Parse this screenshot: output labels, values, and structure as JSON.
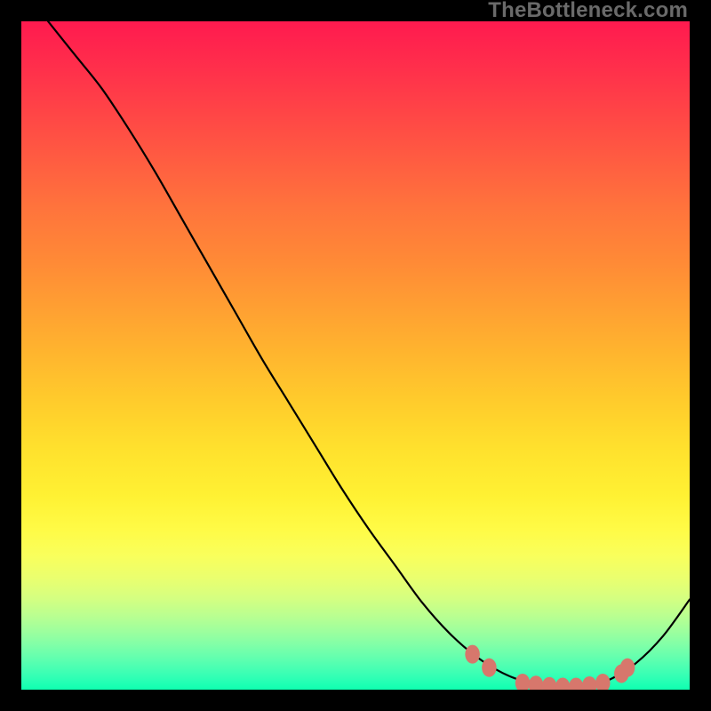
{
  "brand": "TheBottleneck.com",
  "chart_data": {
    "type": "line",
    "title": "",
    "xlabel": "",
    "ylabel": "",
    "xlim": [
      0,
      100
    ],
    "ylim": [
      0,
      100
    ],
    "series": [
      {
        "name": "curve",
        "color": "#000000",
        "x": [
          4,
          8,
          12,
          16,
          20,
          24,
          28,
          32,
          36,
          40,
          44,
          48,
          52,
          56,
          60,
          64,
          68,
          72,
          76,
          80,
          84,
          88,
          92,
          96,
          100
        ],
        "y": [
          100,
          95,
          90,
          84,
          77.5,
          70.5,
          63.5,
          56.5,
          49.5,
          43,
          36.5,
          30,
          24,
          18.5,
          13,
          8.5,
          5,
          2.5,
          1,
          0.3,
          0.3,
          1.5,
          4,
          8,
          13.5
        ]
      }
    ],
    "markers": {
      "rx": 1.1,
      "ry": 1.4,
      "fill": "#d7776c",
      "points": [
        {
          "x": 67.5,
          "y": 5.3
        },
        {
          "x": 70.0,
          "y": 3.3
        },
        {
          "x": 75.0,
          "y": 1.0
        },
        {
          "x": 77.0,
          "y": 0.7
        },
        {
          "x": 79.0,
          "y": 0.5
        },
        {
          "x": 81.0,
          "y": 0.4
        },
        {
          "x": 83.0,
          "y": 0.4
        },
        {
          "x": 85.0,
          "y": 0.6
        },
        {
          "x": 87.0,
          "y": 1.0
        },
        {
          "x": 89.8,
          "y": 2.4
        },
        {
          "x": 90.7,
          "y": 3.3
        }
      ]
    }
  }
}
